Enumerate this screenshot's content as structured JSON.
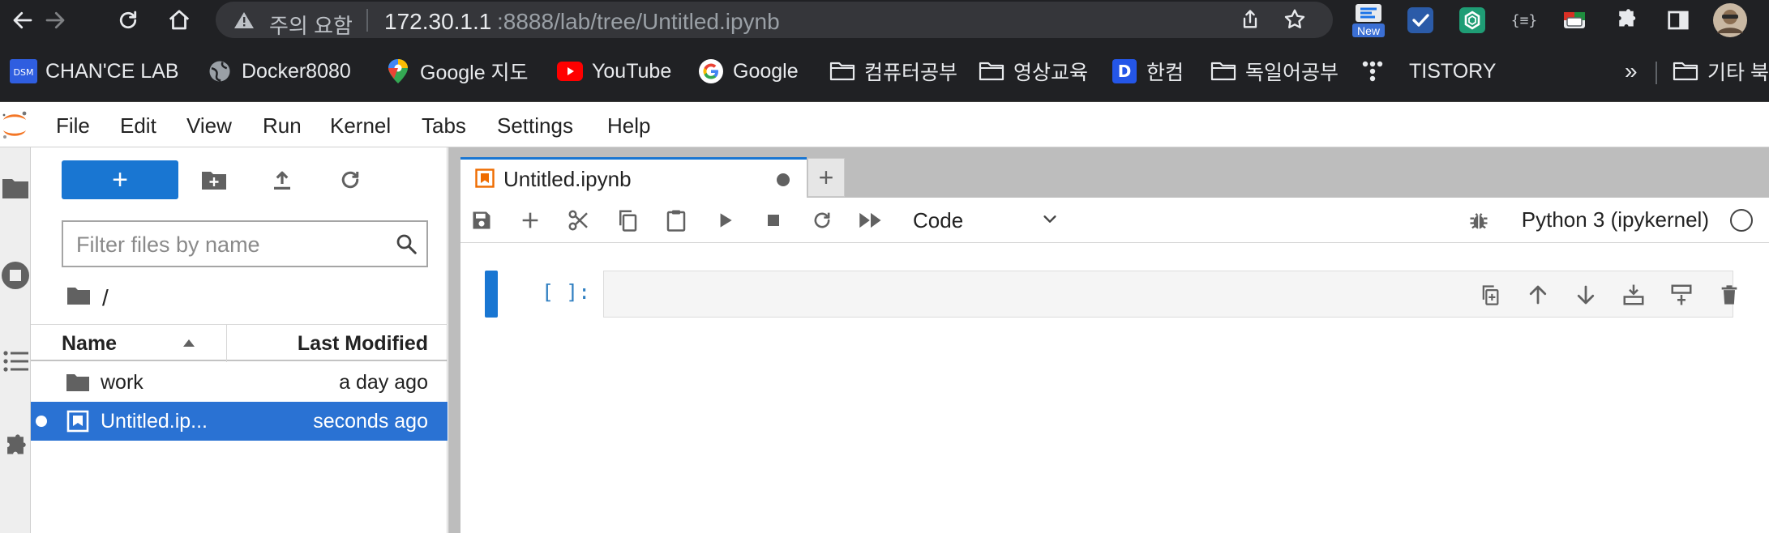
{
  "browser": {
    "security_label": "주의 요함",
    "url_host": "172.30.1.1",
    "url_rest": ":8888/lab/tree/Untitled.ipynb",
    "ext_badge": "New",
    "ext_braces": "{≡}"
  },
  "bookmarks": {
    "items": [
      {
        "label": "CHAN'CE LAB",
        "icon": "dsm-icon"
      },
      {
        "label": "Docker8080",
        "icon": "globe-icon"
      },
      {
        "label": "Google 지도",
        "icon": "maps-pin-icon"
      },
      {
        "label": "YouTube",
        "icon": "youtube-icon"
      },
      {
        "label": "Google",
        "icon": "google-icon"
      },
      {
        "label": "컴퓨터공부",
        "icon": "folder-icon"
      },
      {
        "label": "영상교육",
        "icon": "folder-icon"
      },
      {
        "label": "한컴",
        "icon": "d-icon"
      },
      {
        "label": "독일어공부",
        "icon": "folder-icon"
      },
      {
        "label": "TISTORY",
        "icon": "tistory-icon"
      }
    ],
    "overflow": "»",
    "other": "기타 북"
  },
  "menu": {
    "items": [
      "File",
      "Edit",
      "View",
      "Run",
      "Kernel",
      "Tabs",
      "Settings",
      "Help"
    ]
  },
  "filebrowser": {
    "new_label": "+",
    "filter_placeholder": "Filter files by name",
    "breadcrumb": "/",
    "header_name": "Name",
    "header_modified": "Last Modified",
    "files": [
      {
        "name": "work",
        "modified": "a day ago",
        "icon": "folder-icon",
        "selected": false
      },
      {
        "name": "Untitled.ip...",
        "modified": "seconds ago",
        "icon": "notebook-icon",
        "selected": true
      }
    ]
  },
  "notebook": {
    "tab_label": "Untitled.ipynb",
    "add_tab_label": "+",
    "cell_type": "Code",
    "kernel": "Python 3 (ipykernel)",
    "prompt": "[ ]:"
  },
  "colors": {
    "accent": "#1976d2",
    "selection": "#2a72d3",
    "browser_chrome": "#202124",
    "prompt": "#307fc1"
  }
}
